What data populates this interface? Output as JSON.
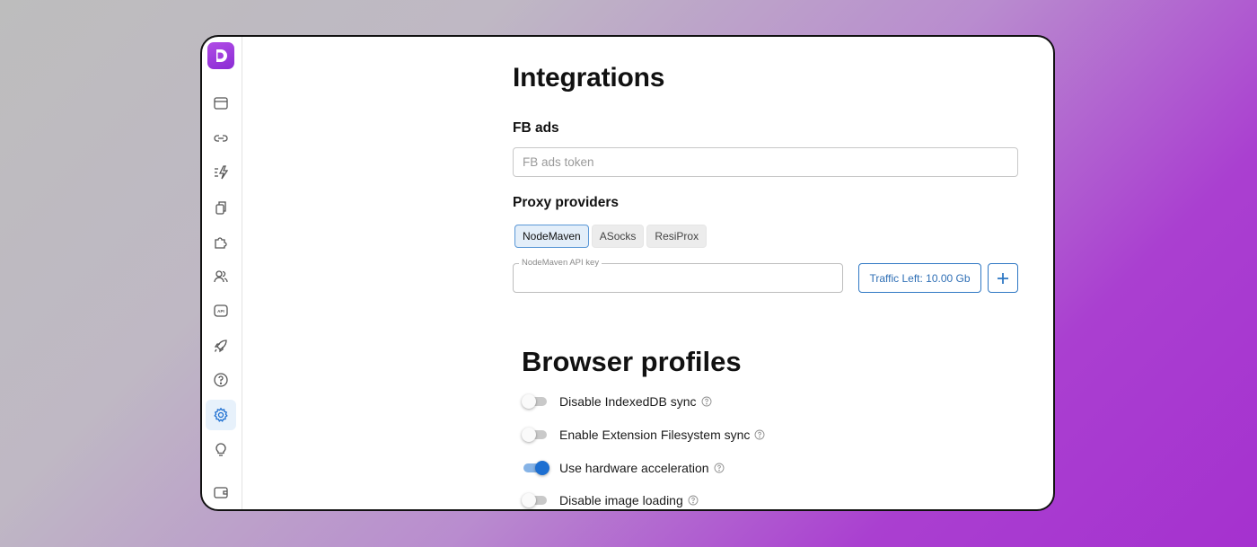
{
  "colors": {
    "accent": "#1d6fd1",
    "brand": "#9b3ddf"
  },
  "sidebar": {
    "logo_icon": "d-logo-icon",
    "items": [
      {
        "icon": "browser-window-icon",
        "active": false
      },
      {
        "icon": "link-icon",
        "active": false
      },
      {
        "icon": "automation-bolt-icon",
        "active": false
      },
      {
        "icon": "copy-icon",
        "active": false
      },
      {
        "icon": "puzzle-extension-icon",
        "active": false
      },
      {
        "icon": "users-icon",
        "active": false
      },
      {
        "icon": "api-icon",
        "active": false
      },
      {
        "icon": "rocket-icon",
        "active": false
      },
      {
        "icon": "help-circle-icon",
        "active": false
      },
      {
        "icon": "settings-gear-icon",
        "active": true
      },
      {
        "icon": "lightbulb-icon",
        "active": false
      },
      {
        "icon": "wallet-icon",
        "active": false
      }
    ]
  },
  "integrations": {
    "title": "Integrations",
    "fb_ads": {
      "label": "FB ads",
      "input_value": "",
      "placeholder": "FB ads token"
    },
    "proxy": {
      "label": "Proxy providers",
      "tabs": [
        {
          "label": "NodeMaven",
          "active": true
        },
        {
          "label": "ASocks",
          "active": false
        },
        {
          "label": "ResiProx",
          "active": false
        }
      ],
      "api_key_label": "NodeMaven API key",
      "api_key_value": "",
      "traffic_button": "Traffic Left: 10.00 Gb",
      "add_icon": "plus-icon"
    }
  },
  "browser_profiles": {
    "title": "Browser profiles",
    "toggles": [
      {
        "label": "Disable IndexedDB sync",
        "on": false
      },
      {
        "label": "Enable Extension Filesystem sync",
        "on": false
      },
      {
        "label": "Use hardware acceleration",
        "on": true
      },
      {
        "label": "Disable image loading",
        "on": false
      }
    ]
  }
}
